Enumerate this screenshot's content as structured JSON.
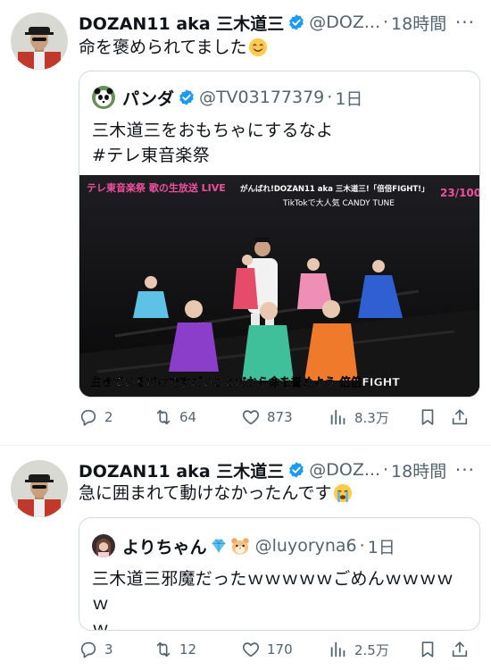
{
  "colors": {
    "text": "#0f1419",
    "secondary": "#536471",
    "verified": "#1d9bf0",
    "border": "#cfd9de"
  },
  "tweets": [
    {
      "name": "DOZAN11 aka 三木道三",
      "handle": "@DOZ...",
      "sep": "·",
      "time": "18時間",
      "more": "···",
      "text": "命を褒められてました",
      "emoji": "smiling-face-emoji",
      "quote": {
        "name": "パンダ",
        "handle": "@TV03177379",
        "sep": "·",
        "time": "1日",
        "lines": [
          "三木道三をおもちゃにするなよ",
          "#テレ東音楽祭"
        ],
        "media": {
          "logo": "テレ東音楽祭 歌の生放送 LIVE",
          "caption_top": "がんばれ!DOZAN11 aka 三木道三!「倍倍FIGHT!」",
          "caption_mid": "TikTokで大人気 CANDY TUNE",
          "counter": "23/100",
          "subtitle": "生きているだけですごいことだから命を誉めよう 倍倍FIGHT"
        }
      },
      "stats": {
        "replies": "2",
        "retweets": "64",
        "likes": "873",
        "views": "8.3万"
      }
    },
    {
      "name": "DOZAN11 aka 三木道三",
      "handle": "@DOZ...",
      "sep": "·",
      "time": "18時間",
      "more": "···",
      "text": "急に囲まれて動けなかったんです",
      "emoji": "crying-face-emoji",
      "quote": {
        "name": "よりちゃん",
        "handle": "@luyoryna6",
        "sep": "·",
        "time": "1日",
        "lines": [
          "三木道三邪魔だったｗｗｗｗｗごめんｗｗｗｗｗ",
          "ｗ"
        ]
      },
      "stats": {
        "replies": "3",
        "retweets": "12",
        "likes": "170",
        "views": "2.5万"
      }
    }
  ]
}
